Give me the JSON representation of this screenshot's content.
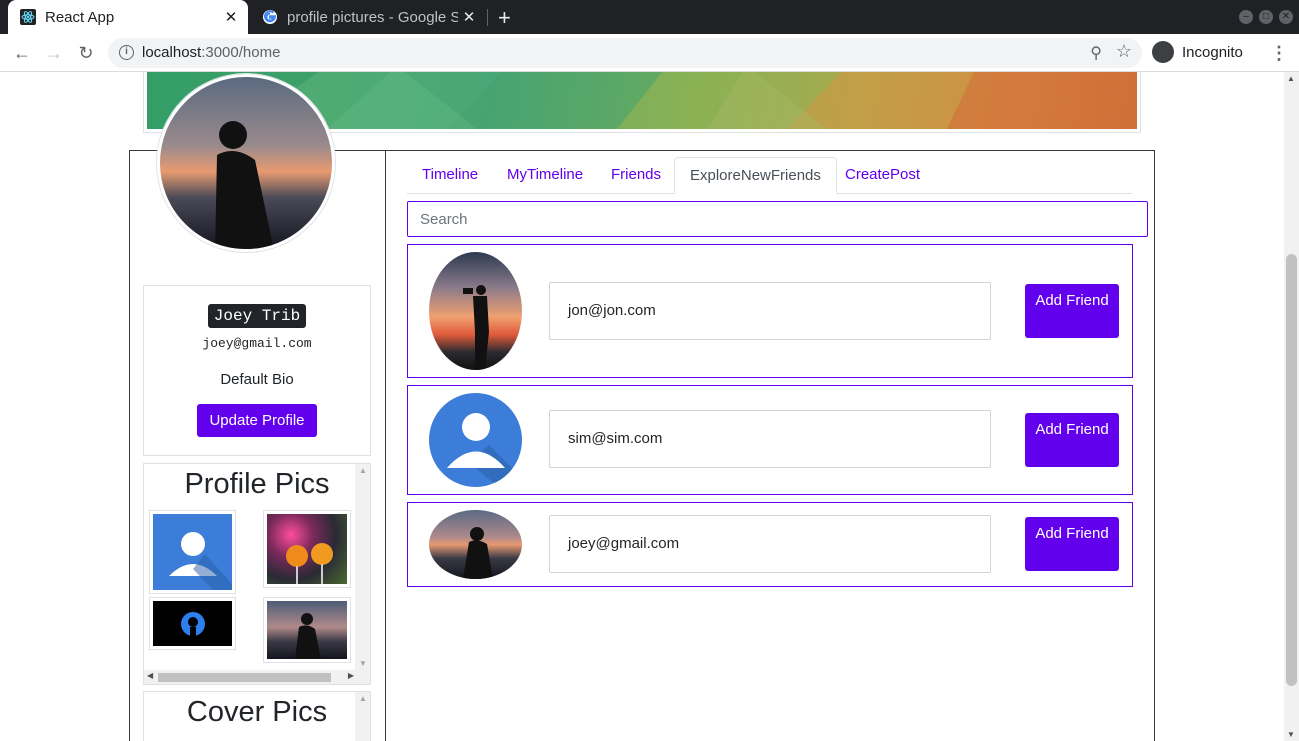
{
  "browser": {
    "tabs": [
      {
        "title": "React App",
        "active": true
      },
      {
        "title": "profile pictures - Google S",
        "active": false
      }
    ],
    "url_host": "localhost",
    "url_path": ":3000/home",
    "profile_label": "Incognito"
  },
  "profile": {
    "name": "Joey Trib",
    "email": "joey@gmail.com",
    "bio": "Default Bio",
    "update_button": "Update Profile"
  },
  "profile_pics": {
    "heading": "Profile Pics"
  },
  "cover_pics": {
    "heading": "Cover Pics"
  },
  "nav": {
    "tabs": [
      {
        "label": "Timeline"
      },
      {
        "label": "MyTimeline"
      },
      {
        "label": "Friends"
      },
      {
        "label": "ExploreNewFriends"
      },
      {
        "label": "CreatePost"
      }
    ],
    "active_tab": "ExploreNewFriends"
  },
  "search": {
    "placeholder": "Search"
  },
  "friends": [
    {
      "email": "jon@jon.com",
      "button": "Add Friend"
    },
    {
      "email": "sim@sim.com",
      "button": "Add Friend"
    },
    {
      "email": "joey@gmail.com",
      "button": "Add Friend"
    }
  ],
  "colors": {
    "accent": "#6200ee",
    "default_avatar_blue": "#3b7dd8"
  }
}
